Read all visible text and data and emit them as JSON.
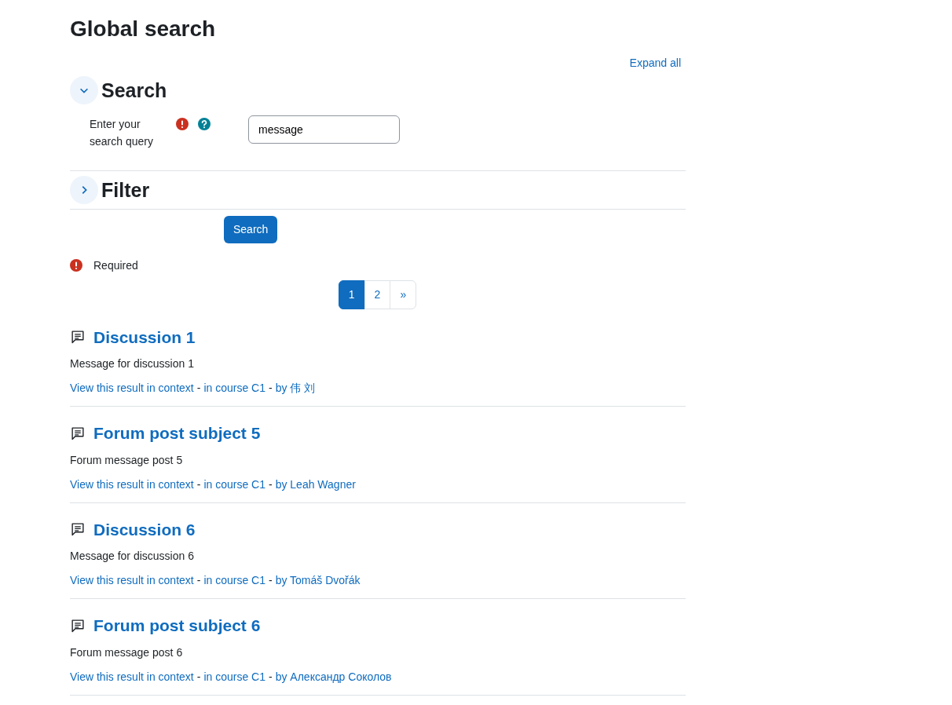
{
  "page_title": "Global search",
  "expand_all": "Expand all",
  "sections": [
    {
      "title": "Search",
      "expanded": true,
      "fields": [
        {
          "label": "Enter your search query",
          "required": true,
          "help": true,
          "value": "message"
        }
      ]
    },
    {
      "title": "Filter",
      "expanded": false
    }
  ],
  "submit_button": "Search",
  "required_note": "Required",
  "pagination": [
    {
      "label": "1",
      "selected": true
    },
    {
      "label": "2",
      "selected": false
    },
    {
      "label": "»",
      "selected": false
    }
  ],
  "results": [
    {
      "title": "Discussion 1",
      "snippet": "Message for discussion 1",
      "context_link": "View this result in context",
      "course_link": "in course C1",
      "author_link": "by 伟 刘"
    },
    {
      "title": "Forum post subject 5",
      "snippet": "Forum message post 5",
      "context_link": "View this result in context",
      "course_link": "in course C1",
      "author_link": "by Leah Wagner"
    },
    {
      "title": "Discussion 6",
      "snippet": "Message for discussion 6",
      "context_link": "View this result in context",
      "course_link": "in course C1",
      "author_link": "by Tomáš Dvořák"
    },
    {
      "title": "Forum post subject 6",
      "snippet": "Forum message post 6",
      "context_link": "View this result in context",
      "course_link": "in course C1",
      "author_link": "by Александр Соколов"
    }
  ],
  "separator": "-"
}
